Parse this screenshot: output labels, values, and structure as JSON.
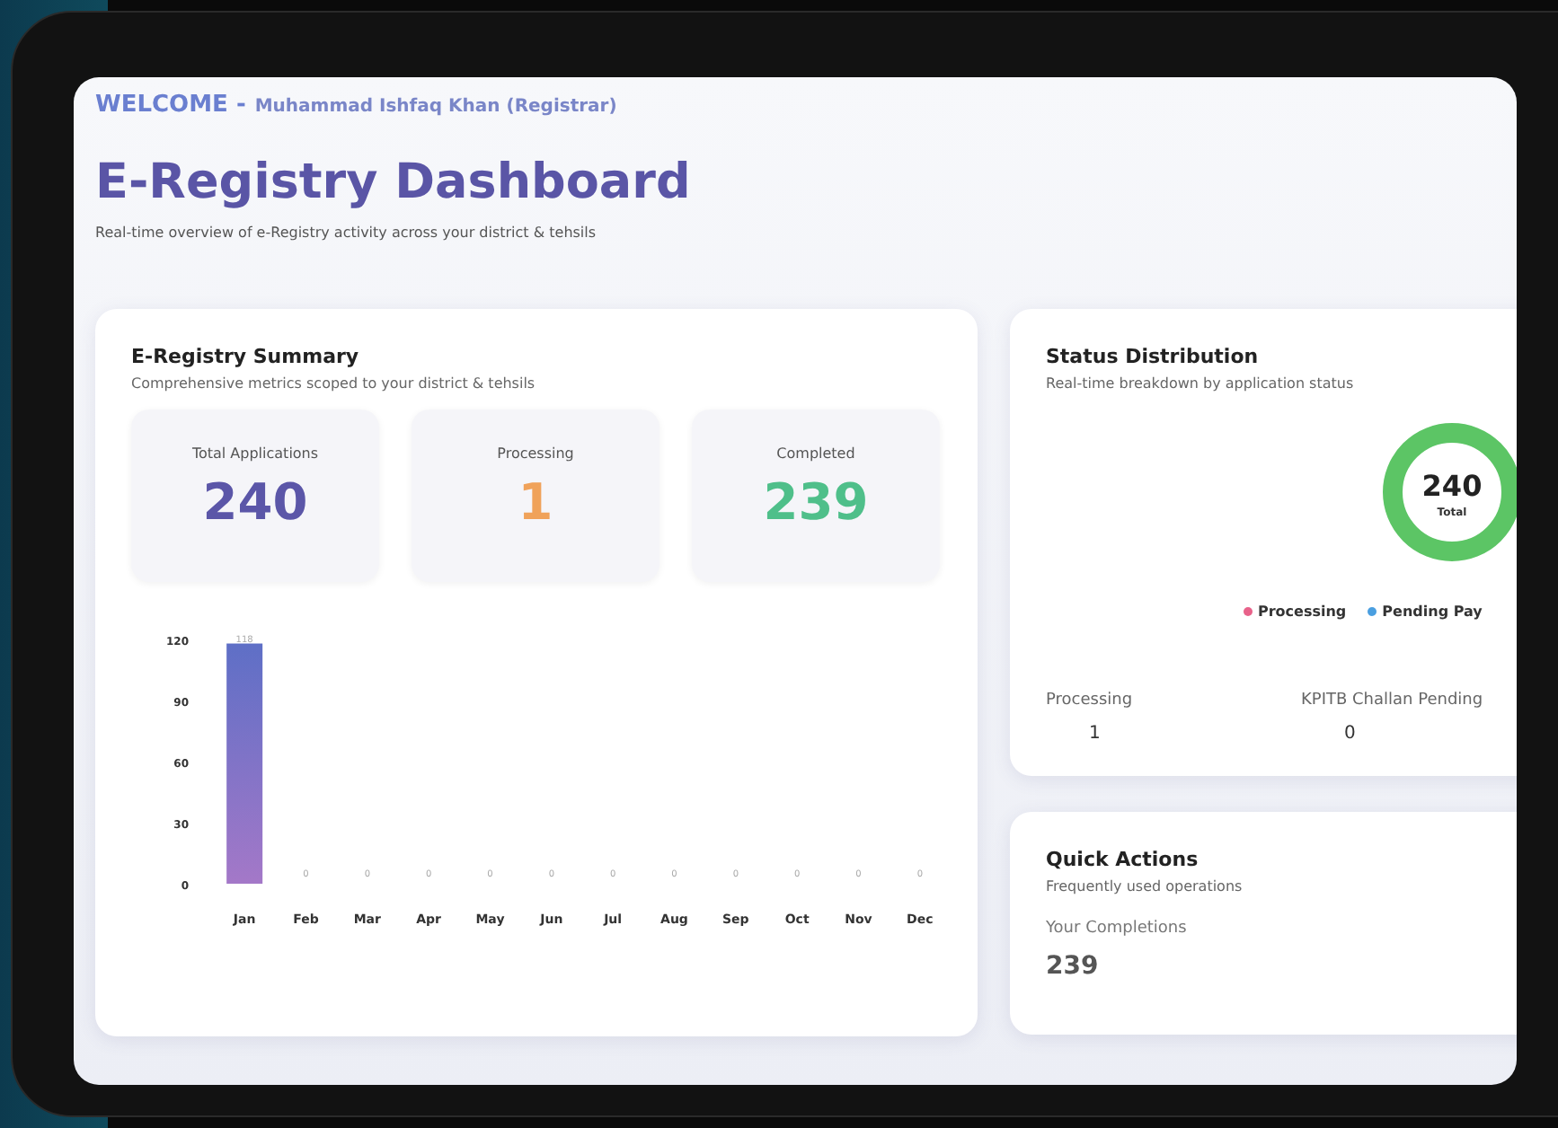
{
  "header": {
    "welcome_label": "WELCOME -",
    "user": "Muhammad Ishfaq Khan (Registrar)",
    "title": "E-Registry Dashboard",
    "subtitle": "Real-time overview of e-Registry activity across your district & tehsils"
  },
  "summary": {
    "title": "E-Registry Summary",
    "subtitle": "Comprehensive metrics scoped to your district & tehsils",
    "metrics": [
      {
        "label": "Total Applications",
        "value": "240",
        "color": "#5b56a8"
      },
      {
        "label": "Processing",
        "value": "1",
        "color": "#f0a25a"
      },
      {
        "label": "Completed",
        "value": "239",
        "color": "#4fbf8a"
      }
    ],
    "chart_data": {
      "type": "bar",
      "categories": [
        "Jan",
        "Feb",
        "Mar",
        "Apr",
        "May",
        "Jun",
        "Jul",
        "Aug",
        "Sep",
        "Oct",
        "Nov",
        "Dec"
      ],
      "values": [
        118,
        0,
        0,
        0,
        0,
        0,
        0,
        0,
        0,
        0,
        0,
        0
      ],
      "ylim": [
        0,
        120
      ],
      "yticks": [
        0,
        30,
        60,
        90,
        120
      ],
      "data_labels": true
    }
  },
  "status": {
    "title": "Status Distribution",
    "subtitle": "Real-time breakdown by application status",
    "total": "240",
    "total_label": "Total",
    "legend": [
      {
        "label": "Processing",
        "color": "#e8628a"
      },
      {
        "label": "Pending Pay",
        "color": "#4a9fe0"
      }
    ],
    "stats": [
      {
        "label": "Processing",
        "value": "1"
      },
      {
        "label": "KPITB Challan Pending",
        "value": "0"
      }
    ]
  },
  "quick_actions": {
    "title": "Quick Actions",
    "subtitle": "Frequently used operations",
    "stat_label": "Your Completions",
    "stat_value": "239"
  }
}
